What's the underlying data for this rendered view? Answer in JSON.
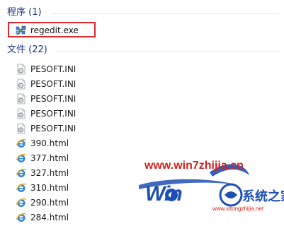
{
  "programs": {
    "header": "程序 (1)",
    "items": [
      {
        "label": "regedit.exe",
        "icon": "registry-editor-icon"
      }
    ]
  },
  "files": {
    "header": "文件 (22)",
    "items": [
      {
        "label": "PESOFT.INI",
        "icon": "ini-file-icon"
      },
      {
        "label": "PESOFT.INI",
        "icon": "ini-file-icon"
      },
      {
        "label": "PESOFT.INI",
        "icon": "ini-file-icon"
      },
      {
        "label": "PESOFT.INI",
        "icon": "ini-file-icon"
      },
      {
        "label": "PESOFT.INI",
        "icon": "ini-file-icon"
      },
      {
        "label": "390.html",
        "icon": "ie-html-icon"
      },
      {
        "label": "377.html",
        "icon": "ie-html-icon"
      },
      {
        "label": "327.html",
        "icon": "ie-html-icon"
      },
      {
        "label": "310.html",
        "icon": "ie-html-icon"
      },
      {
        "label": "290.html",
        "icon": "ie-html-icon"
      },
      {
        "label": "284.html",
        "icon": "ie-html-icon"
      }
    ]
  },
  "watermark": {
    "url": "www.win7zhijia.cn",
    "brand": "系统之家",
    "sub": "www.xitongzhijia.net",
    "logo_letters": "Win"
  },
  "colors": {
    "header_text": "#1e3287",
    "highlight_border": "#e0282a",
    "watermark_red": "#d42020",
    "watermark_blue": "#1e50b4"
  }
}
